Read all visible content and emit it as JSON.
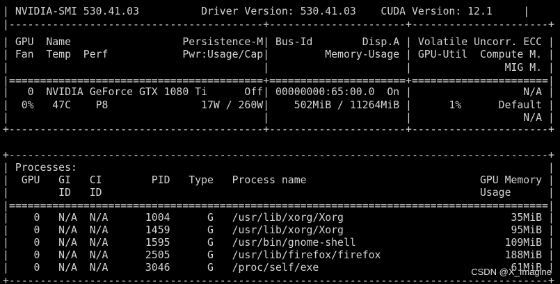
{
  "terminal": {
    "lines": [
      "| NVIDIA-SMI 530.41.03          Driver Version: 530.41.03    CUDA Version: 12.1     |",
      "|-----------------------------------------+----------------------+----------------------+",
      "| GPU  Name                  Persistence-M| Bus-Id        Disp.A | Volatile Uncorr. ECC |",
      "| Fan  Temp  Perf            Pwr:Usage/Cap|         Memory-Usage | GPU-Util  Compute M. |",
      "|                                         |                      |               MIG M. |",
      "|=========================================+======================+======================|",
      "|   0  NVIDIA GeForce GTX 1080 Ti      Off| 00000000:65:00.0  On |                  N/A |",
      "|  0%   47C    P8               17W / 260W|    502MiB / 11264MiB |      1%      Default |",
      "|                                         |                      |                  N/A |",
      "+-----------------------------------------+----------------------+----------------------+",
      "",
      "+---------------------------------------------------------------------------------------+",
      "| Processes:                                                                            |",
      "|  GPU   GI   CI        PID   Type   Process name                            GPU Memory |",
      "|        ID   ID                                                             Usage      |",
      "|=======================================================================================|",
      "|    0   N/A  N/A      1004      G   /usr/lib/xorg/Xorg                           35MiB |",
      "|    0   N/A  N/A      1459      G   /usr/lib/xorg/Xorg                           95MiB |",
      "|    0   N/A  N/A      1595      G   /usr/bin/gnome-shell                        109MiB |",
      "|    0   N/A  N/A      2505      G   /usr/lib/firefox/firefox                    188MiB |",
      "|    0   N/A  N/A      3046      G   /proc/self/exe                               61MiB |",
      "+---------------------------------------------------------------------------------------+"
    ]
  },
  "watermark": "CSDN @X_Imagine"
}
